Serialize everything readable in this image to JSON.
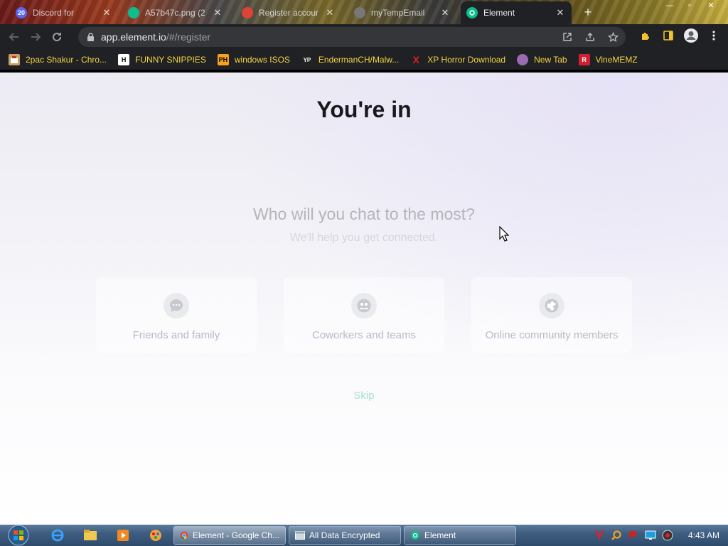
{
  "browser": {
    "tabs": [
      {
        "label": "Discord for",
        "icon": "discord-icon"
      },
      {
        "label": "A57b47c.png (2",
        "icon": "element-icon"
      },
      {
        "label": "Register accoun",
        "icon": "chrome-icon"
      },
      {
        "label": "myTempEmail",
        "icon": "mail-icon"
      },
      {
        "label": "Element",
        "icon": "element-icon",
        "active": true
      }
    ],
    "tab_badge": "20",
    "url_domain": "app.element.io",
    "url_path": "/#/register"
  },
  "bookmarks": [
    {
      "label": "2pac Shakur - Chro...",
      "icon": "music-icon"
    },
    {
      "label": "FUNNY SNIPPIES",
      "icon": "h-icon",
      "glyph": "H"
    },
    {
      "label": "windows ISOS",
      "icon": "ph-icon",
      "glyph": "PH"
    },
    {
      "label": "EndermanCH/Malw...",
      "icon": "youtube-icon",
      "glyph": "YP"
    },
    {
      "label": "XP Horror Download",
      "icon": "x-icon",
      "glyph": "X"
    },
    {
      "label": "New Tab",
      "icon": "globe-icon"
    },
    {
      "label": "VineMEMZ",
      "icon": "r-icon",
      "glyph": "R"
    }
  ],
  "page": {
    "title": "You're in",
    "question": "Who will you chat to the most?",
    "subtitle": "We'll help you get connected.",
    "choices": [
      {
        "label": "Friends and family",
        "icon": "chat-bubble-icon"
      },
      {
        "label": "Coworkers and teams",
        "icon": "team-icon"
      },
      {
        "label": "Online community members",
        "icon": "globe-icon"
      }
    ],
    "skip_label": "Skip"
  },
  "taskbar": {
    "tasks": [
      {
        "label": "Element - Google Ch...",
        "icon": "chrome-icon"
      },
      {
        "label": "All Data Encrypted",
        "icon": "window-icon"
      },
      {
        "label": "Element",
        "icon": "element-icon"
      }
    ],
    "clock": "4:43 AM"
  },
  "colors": {
    "chrome_dark": "#202124",
    "bookmark_text": "#f5d442",
    "skip_accent": "#a9ddd3",
    "taskbar": "#3e5d80"
  }
}
